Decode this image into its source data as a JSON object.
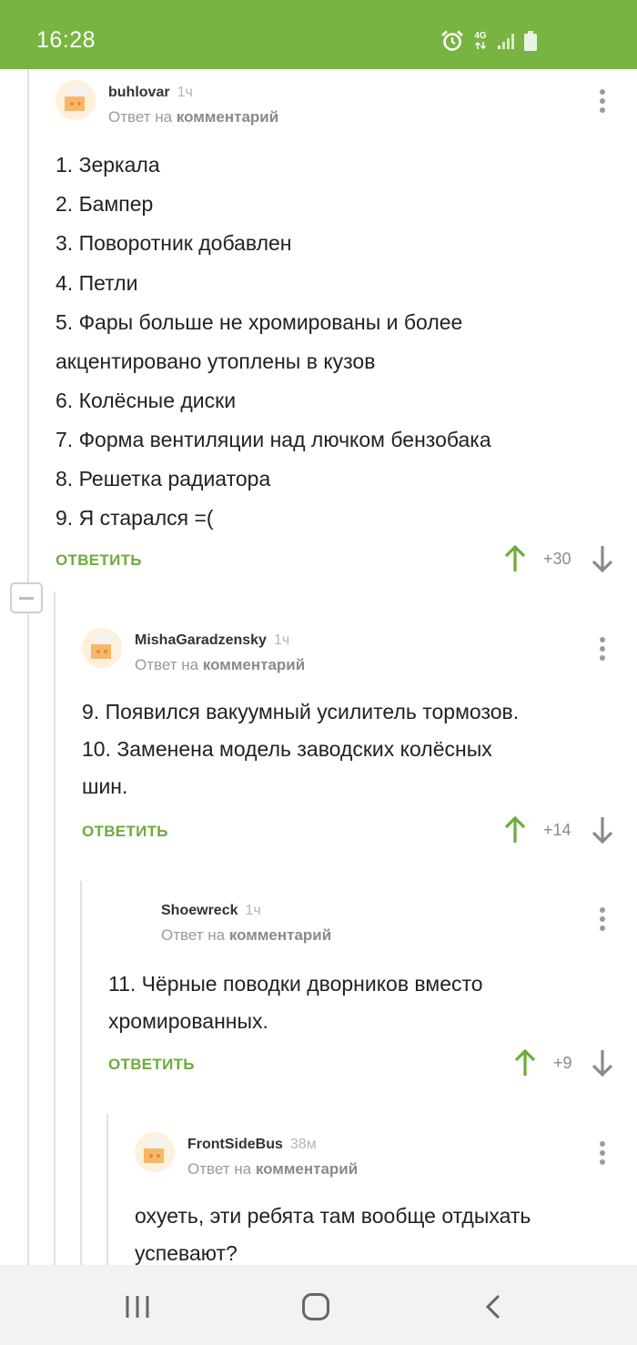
{
  "status": {
    "time": "16:28",
    "network": "4G"
  },
  "comments": [
    {
      "author": "buhlovar",
      "time": "1ч",
      "reply_prefix": "Ответ на",
      "reply_target": "комментарий",
      "lines": [
        "1. Зеркала",
        "2. Бампер",
        "3. Поворотник добавлен",
        "4. Петли",
        "5. Фары больше не хромированы и более",
        "акцентировано утоплены в кузов",
        "6. Колёсные диски",
        "7. Форма вентиляции над лючком бензобака",
        "8. Решетка радиатора",
        "9. Я старался =("
      ],
      "reply_label": "ОТВЕТИТЬ",
      "rating": "+30"
    },
    {
      "author": "MishaGaradzensky",
      "time": "1ч",
      "reply_prefix": "Ответ на",
      "reply_target": "комментарий",
      "lines": [
        "9. Появился вакуумный усилитель тормозов.",
        "10. Заменена модель заводских колёсных",
        "шин."
      ],
      "reply_label": "ОТВЕТИТЬ",
      "rating": "+14"
    },
    {
      "author": "Shoewreck",
      "time": "1ч",
      "reply_prefix": "Ответ на",
      "reply_target": "комментарий",
      "lines": [
        "11. Чёрные поводки дворников вместо",
        "хромированных."
      ],
      "reply_label": "ОТВЕТИТЬ",
      "rating": "+9"
    },
    {
      "author": "FrontSideBus",
      "time": "38м",
      "reply_prefix": "Ответ на",
      "reply_target": "комментарий",
      "lines": [
        "охуеть, эти ребята там вообще отдыхать",
        "успевают?"
      ]
    }
  ],
  "colors": {
    "brand": "#78b441",
    "reply": "#6cac3a",
    "upvote": "#6cac3a",
    "downvote": "#8a8a8a"
  },
  "icons": [
    "alarm-icon",
    "signal-icon",
    "battery-icon",
    "upvote-icon",
    "downvote-icon",
    "more-icon",
    "recents-icon",
    "home-icon",
    "back-icon"
  ]
}
